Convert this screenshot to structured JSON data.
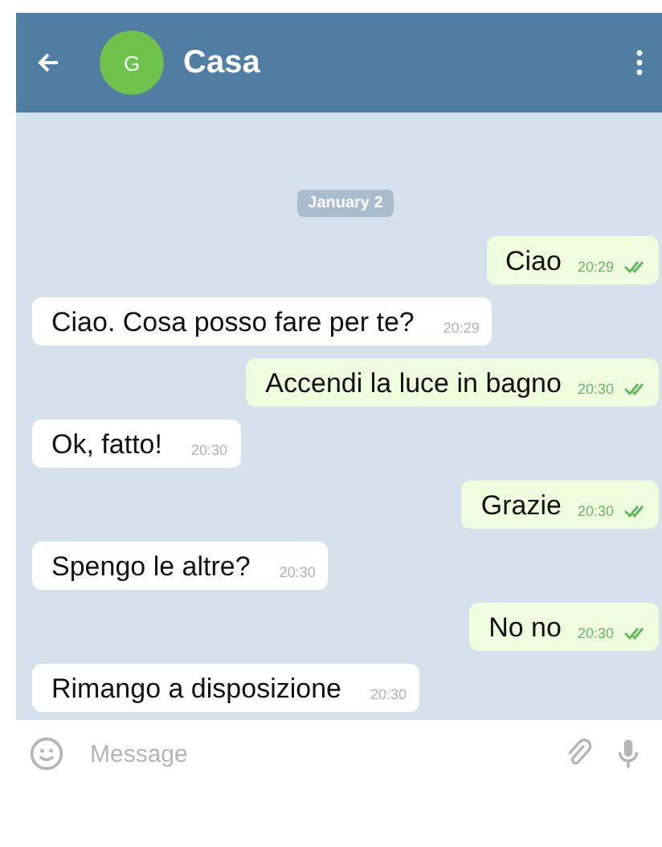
{
  "header": {
    "avatar_letter": "G",
    "title": "Casa"
  },
  "date_chip": "January 2",
  "messages": [
    {
      "kind": "outgoing",
      "text": "Ciao",
      "time": "20:29",
      "read": true
    },
    {
      "kind": "incoming",
      "text": "Ciao. Cosa posso fare per te?",
      "time": "20:29"
    },
    {
      "kind": "outgoing",
      "text": "Accendi la luce in bagno",
      "time": "20:30",
      "read": true
    },
    {
      "kind": "incoming",
      "text": "Ok, fatto!",
      "time": "20:30"
    },
    {
      "kind": "outgoing",
      "text": "Grazie",
      "time": "20:30",
      "read": true
    },
    {
      "kind": "incoming",
      "text": "Spengo le altre?",
      "time": "20:30"
    },
    {
      "kind": "outgoing",
      "text": "No no",
      "time": "20:30",
      "read": true
    },
    {
      "kind": "incoming",
      "text": "Rimango a disposizione",
      "time": "20:30"
    }
  ],
  "composer": {
    "placeholder": "Message"
  }
}
